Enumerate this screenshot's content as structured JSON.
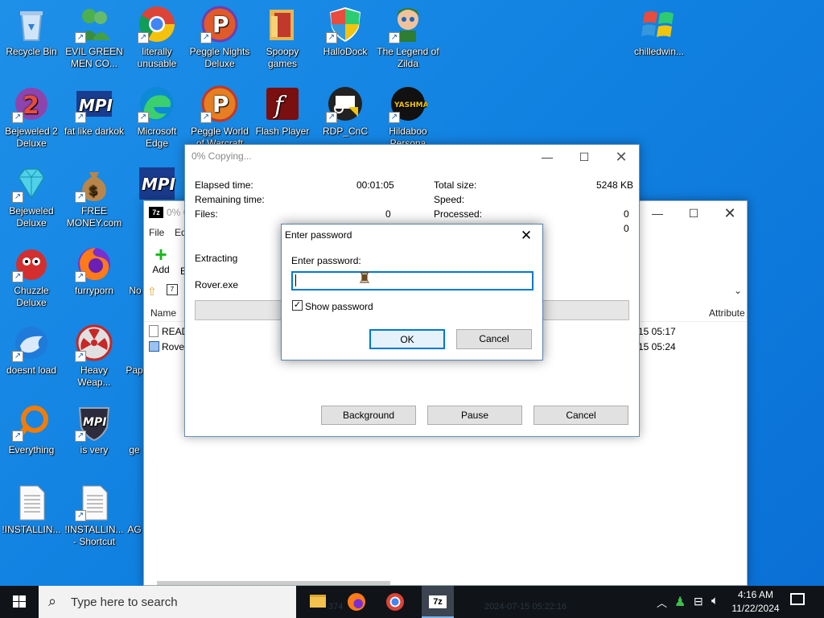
{
  "desktop": {
    "icons": [
      {
        "label": "Recycle Bin"
      },
      {
        "label": "EVIL GREEN MEN CO..."
      },
      {
        "label": "literally unusable"
      },
      {
        "label": "Peggle Nights Deluxe"
      },
      {
        "label": "Spoopy games"
      },
      {
        "label": "HalloDock"
      },
      {
        "label": "The Legend of Zilda"
      },
      {
        "label": "chilledwin..."
      },
      {
        "label": "Bejeweled 2 Deluxe"
      },
      {
        "label": "fat like darkok"
      },
      {
        "label": "Microsoft Edge"
      },
      {
        "label": "Peggle World of Warcraft"
      },
      {
        "label": "Flash Player"
      },
      {
        "label": "RDP_CnC"
      },
      {
        "label": "Hildaboo Persona"
      },
      {
        "label": "Bejeweled Deluxe"
      },
      {
        "label": "FREE MONEY.com"
      },
      {
        "label": "Chuzzle Deluxe"
      },
      {
        "label": "furryporn"
      },
      {
        "label": "doesnt load"
      },
      {
        "label": "Heavy Weap..."
      },
      {
        "label": "Everything"
      },
      {
        "label": "is very"
      },
      {
        "label": "!INSTALLIN..."
      },
      {
        "label": "!INSTALLIN... - Shortcut"
      },
      {
        "label": "No"
      },
      {
        "label": "Pap"
      },
      {
        "label": "ge"
      },
      {
        "label": "AG"
      }
    ]
  },
  "archive_window": {
    "title": "0% C",
    "menu_file": "File",
    "menu_edit": "Ed",
    "toolbar_add": "Add",
    "toolbar_extra": "E",
    "col_name": "Name",
    "col_attributes": "Attribute",
    "rows": [
      {
        "name": "READ",
        "date": "15 05:17"
      },
      {
        "name": "Rover",
        "date": "15 05:24"
      }
    ],
    "status_partial": "374",
    "status_date": "2024-07-15 05:22:16"
  },
  "copy_dialog": {
    "title": "0% Copying...",
    "elapsed_label": "Elapsed time:",
    "elapsed_value": "00:01:05",
    "remaining_label": "Remaining time:",
    "files_label": "Files:",
    "files_value": "0",
    "total_size_label": "Total size:",
    "total_size_value": "5248 KB",
    "speed_label": "Speed:",
    "processed_label": "Processed:",
    "processed_value": "0",
    "extra_value": "0",
    "extracting_label": "Extracting",
    "current_file": "Rover.exe",
    "background_button": "Background",
    "pause_button": "Pause",
    "cancel_button": "Cancel"
  },
  "password_dialog": {
    "title": "Enter password",
    "field_label": "Enter password:",
    "field_value": "",
    "show_password_label": "Show password",
    "show_password_checked": true,
    "ok_button": "OK",
    "cancel_button": "Cancel"
  },
  "taskbar": {
    "search_placeholder": "Type here to search",
    "time": "4:16 AM",
    "date": "11/22/2024"
  },
  "colors": {
    "desktop_blue": "#1080e0",
    "focus_blue": "#0078d7",
    "taskbar": "#101418"
  }
}
